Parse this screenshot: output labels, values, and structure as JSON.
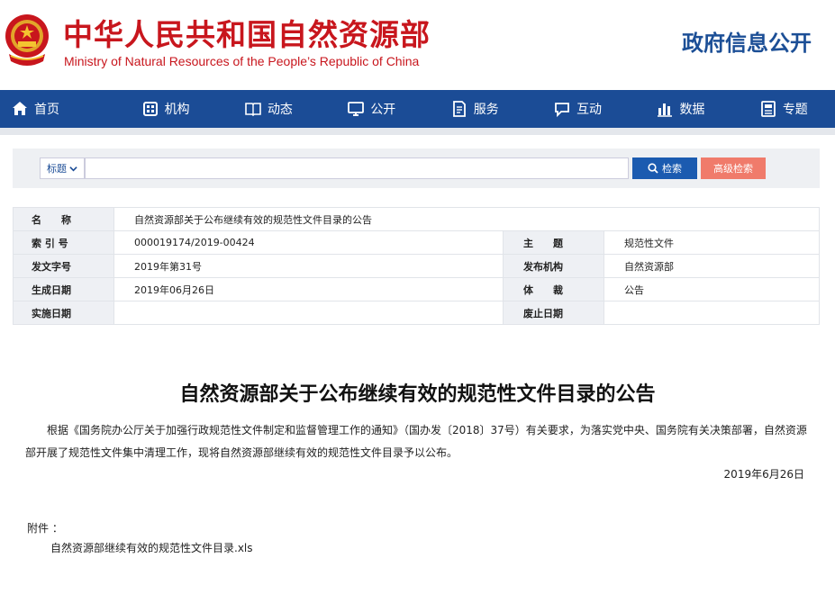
{
  "header": {
    "title_cn": "中华人民共和国自然资源部",
    "title_en": "Ministry of Natural Resources of the People’s Republic of China",
    "right_label": "政府信息公开"
  },
  "nav": {
    "items": [
      {
        "label": "首页",
        "icon": "home-icon"
      },
      {
        "label": "机构",
        "icon": "organization-icon"
      },
      {
        "label": "动态",
        "icon": "book-icon"
      },
      {
        "label": "公开",
        "icon": "monitor-icon"
      },
      {
        "label": "服务",
        "icon": "document-icon"
      },
      {
        "label": "互动",
        "icon": "chat-icon"
      },
      {
        "label": "数据",
        "icon": "bar-chart-icon"
      },
      {
        "label": "专题",
        "icon": "topic-icon"
      }
    ]
  },
  "search": {
    "select_value": "标题",
    "input_value": "",
    "search_label": "检索",
    "advanced_label": "高级检索"
  },
  "info": {
    "name_label": "名　　称",
    "name_value": "自然资源部关于公布继续有效的规范性文件目录的公告",
    "index_label": "索 引 号",
    "index_value": "000019174/2019-00424",
    "subject_label": "主　　题",
    "subject_value": "规范性文件",
    "docno_label": "发文字号",
    "docno_value": "2019年第31号",
    "issuer_label": "发布机构",
    "issuer_value": "自然资源部",
    "created_label": "生成日期",
    "created_value": "2019年06月26日",
    "genre_label": "体　　裁",
    "genre_value": "公告",
    "effective_label": "实施日期",
    "effective_value": "",
    "repeal_label": "废止日期",
    "repeal_value": ""
  },
  "article": {
    "title": "自然资源部关于公布继续有效的规范性文件目录的公告",
    "body": "根据《国务院办公厅关于加强行政规范性文件制定和监督管理工作的通知》（国办发〔2018〕37号）有关要求，为落实党中央、国务院有关决策部署，自然资源部开展了规范性文件集中清理工作，现将自然资源部继续有效的规范性文件目录予以公布。",
    "date": "2019年6月26日",
    "attachment_label": "附件 ：",
    "attachment_file": "自然资源部继续有效的规范性文件目录.xls"
  },
  "colors": {
    "brand_red": "#c8161d",
    "nav_blue": "#1b4c96",
    "search_blue": "#1b5bb0",
    "advanced_salmon": "#f07b6b"
  }
}
